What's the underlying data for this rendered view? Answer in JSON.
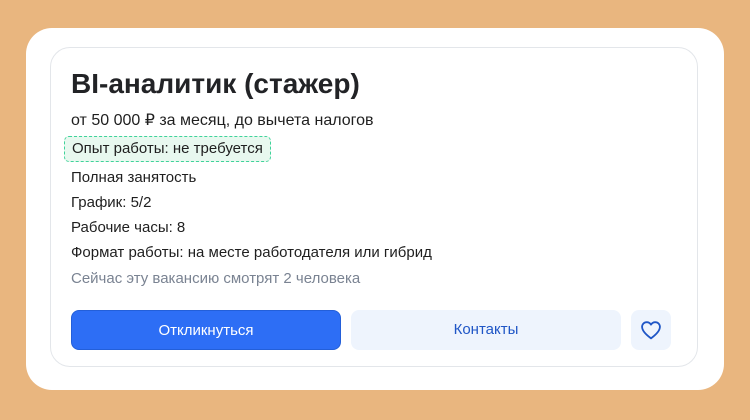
{
  "vacancy": {
    "title": "BI-аналитик (стажер)",
    "salary": "от 50 000 ₽ за месяц, до вычета налогов",
    "experience": "Опыт работы: не требуется",
    "employment": "Полная занятость",
    "schedule": "График: 5/2",
    "hours": "Рабочие часы: 8",
    "work_format": "Формат работы: на месте работодателя или гибрид",
    "viewers_note": "Сейчас эту вакансию смотрят 2 человека"
  },
  "actions": {
    "respond_label": "Откликнуться",
    "contacts_label": "Контакты",
    "favorite_icon": "heart-outline-icon"
  },
  "colors": {
    "page_background": "#e9b67f",
    "primary_button": "#2d6ef5",
    "secondary_button": "#eef4fd",
    "secondary_text": "#1f56c6",
    "highlight_border": "#3fd39a",
    "highlight_fill": "#e8f8ef",
    "muted_text": "#7a8392"
  }
}
